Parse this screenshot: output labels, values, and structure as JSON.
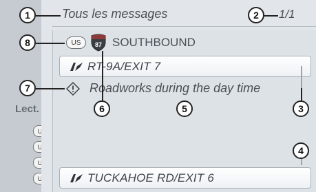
{
  "header": {
    "title": "Tous les messages",
    "page": "1/1"
  },
  "road": {
    "badge": "US",
    "shield_number": "87",
    "name": "SOUTHBOUND"
  },
  "items": [
    {
      "label": "RT-9A/EXIT 7",
      "icon": "route-exit-icon"
    },
    {
      "label": "TUCKAHOE RD/EXIT 6",
      "icon": "route-exit-icon"
    }
  ],
  "message": {
    "text": "Roadworks during the day time",
    "icon": "warning-icon"
  },
  "background_list": {
    "heading": "Lect.",
    "badges": [
      "US",
      "US",
      "US",
      "US"
    ]
  },
  "callouts": [
    "1",
    "2",
    "3",
    "4",
    "5",
    "6",
    "7",
    "8"
  ],
  "colors": {
    "panel": "#e2e6ea",
    "strip": "#c5cbd1",
    "text": "#4a4f55"
  }
}
